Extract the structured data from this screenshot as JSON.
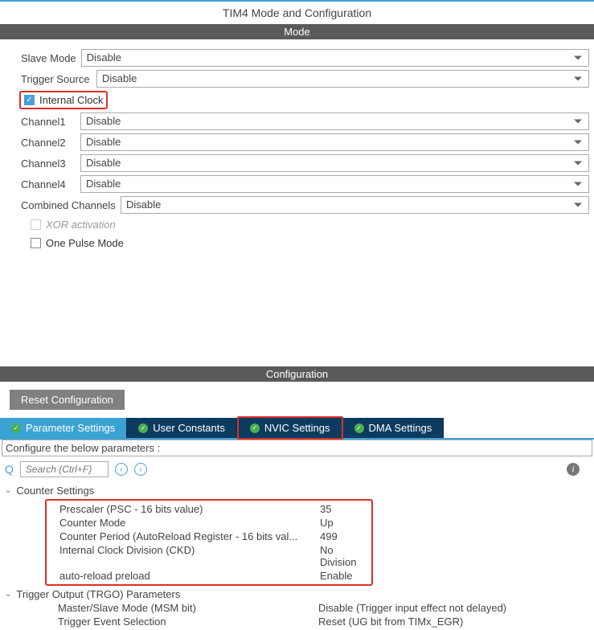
{
  "title": "TIM4 Mode and Configuration",
  "sections": {
    "mode": "Mode",
    "config": "Configuration"
  },
  "mode": {
    "slave_mode": {
      "label": "Slave Mode",
      "value": "Disable"
    },
    "trigger_source": {
      "label": "Trigger Source",
      "value": "Disable"
    },
    "internal_clock": {
      "label": "Internal Clock",
      "checked": true
    },
    "channel1": {
      "label": "Channel1",
      "value": "Disable"
    },
    "channel2": {
      "label": "Channel2",
      "value": "Disable"
    },
    "channel3": {
      "label": "Channel3",
      "value": "Disable"
    },
    "channel4": {
      "label": "Channel4",
      "value": "Disable"
    },
    "combined": {
      "label": "Combined Channels",
      "value": "Disable"
    },
    "xor": {
      "label": "XOR activation",
      "checked": false
    },
    "one_pulse": {
      "label": "One Pulse Mode",
      "checked": false
    }
  },
  "config": {
    "reset_btn": "Reset Configuration",
    "tabs": {
      "param": "Parameter Settings",
      "user": "User Constants",
      "nvic": "NVIC Settings",
      "dma": "DMA Settings"
    },
    "subtitle": "Configure the below parameters :",
    "search_placeholder": "Search (Ctrl+F)",
    "groups": {
      "counter": {
        "title": "Counter Settings",
        "rows": [
          {
            "label": "Prescaler (PSC - 16 bits value)",
            "value": "35"
          },
          {
            "label": "Counter Mode",
            "value": "Up"
          },
          {
            "label": "Counter Period (AutoReload Register - 16 bits val...",
            "value": "499"
          },
          {
            "label": "Internal Clock Division (CKD)",
            "value": "No Division"
          },
          {
            "label": "auto-reload preload",
            "value": "Enable"
          }
        ]
      },
      "trgo": {
        "title": "Trigger Output (TRGO) Parameters",
        "rows": [
          {
            "label": "Master/Slave Mode (MSM bit)",
            "value": "Disable (Trigger input effect not delayed)"
          },
          {
            "label": "Trigger Event Selection",
            "value": "Reset (UG bit from TIMx_EGR)"
          }
        ]
      }
    }
  }
}
